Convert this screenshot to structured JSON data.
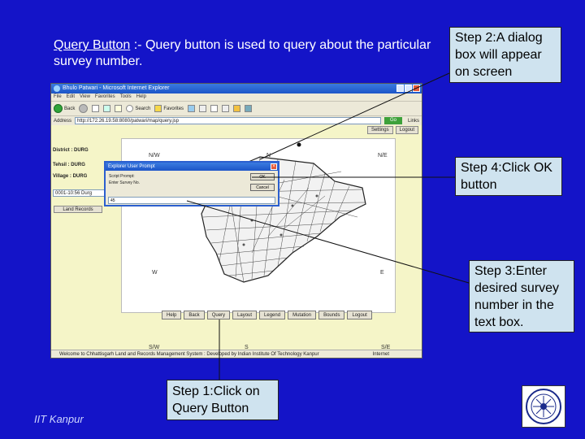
{
  "slide": {
    "intro_term": "Query Button",
    "intro_text": " :- Query button is used to query about the particular survey number.",
    "footer_institution": "IIT Kanpur",
    "logo": "institute-seal-icon"
  },
  "callouts": {
    "step1": "Step 1:Click on Query Button",
    "step2": "Step 2:A dialog box will appear on screen",
    "step3": "Step 3:Enter desired survey number in the text box.",
    "step4": "Step 4:Click OK button"
  },
  "browser": {
    "window_title": "Bhulo Patwari - Microsoft Internet Explorer",
    "menu": [
      "File",
      "Edit",
      "View",
      "Favorites",
      "Tools",
      "Help"
    ],
    "toolbar": {
      "back": "Back",
      "search": "Search",
      "favorites": "Favorites"
    },
    "address_label": "Address",
    "address_value": "http://172.26.19.58:8080/patwari/map/query.jsp",
    "go_label": "Go",
    "links_label": "Links",
    "left_panel": {
      "district": "District : DURG",
      "tehsil": "Tehsil : DURG",
      "village": "Village : DURG",
      "select_value": "0001-10:56 Durg",
      "button": "Land Records"
    },
    "top_actions": [
      "Settings",
      "Logout"
    ],
    "directions": {
      "nw": "N/W",
      "n": "N",
      "ne": "N/E",
      "w": "W",
      "e": "E",
      "sw": "S/W",
      "s": "S",
      "se": "S/E"
    },
    "bottom_buttons": [
      "Help",
      "Back",
      "Query",
      "Layout",
      "Legend",
      "Mutation",
      "Bounds",
      "Logout"
    ],
    "status_text": "Welcome to Chhattisgarh Land and Records Management System : Developed by Indian Institute Of Technology Kanpur",
    "status_zone": "Internet"
  },
  "dialog": {
    "title": "Explorer User Prompt",
    "script_prompt_label": "Script Prompt:",
    "message": "Enter Survey No.",
    "ok": "OK",
    "cancel": "Cancel",
    "input_value": "45"
  }
}
